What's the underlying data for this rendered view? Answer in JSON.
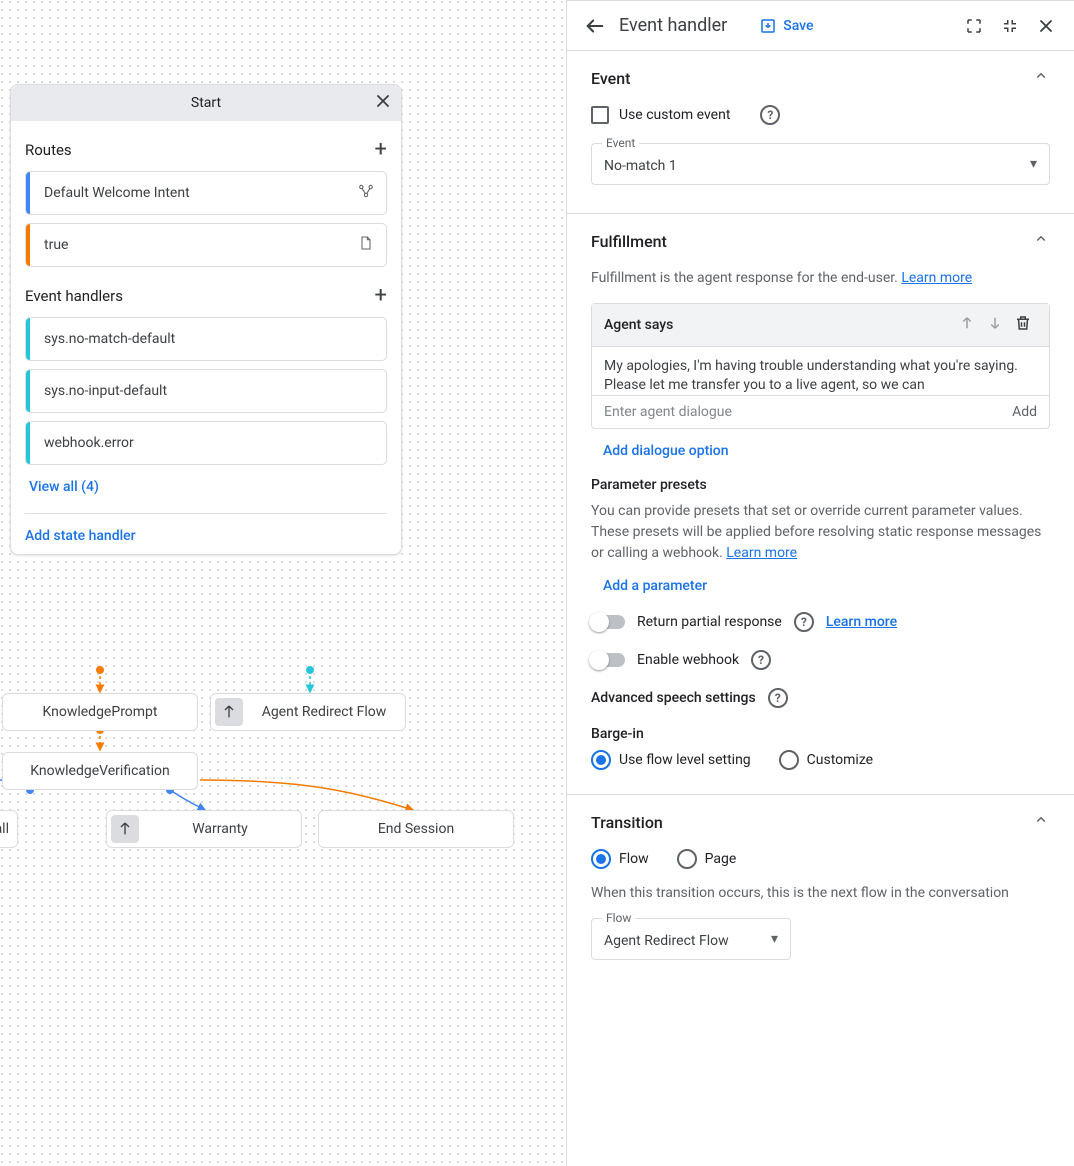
{
  "canvas": {
    "start_title": "Start",
    "routes_label": "Routes",
    "routes": [
      {
        "label": "Default Welcome Intent",
        "bar": "bar-blue",
        "icon": "branch"
      },
      {
        "label": "true",
        "bar": "bar-orange",
        "icon": "doc"
      }
    ],
    "handlers_label": "Event handlers",
    "handlers": [
      {
        "label": "sys.no-match-default",
        "bar": "bar-teal"
      },
      {
        "label": "sys.no-input-default",
        "bar": "bar-teal"
      },
      {
        "label": "webhook.error",
        "bar": "bar-teal"
      }
    ],
    "view_all": "View all (4)",
    "add_state": "Add state handler",
    "nodes": {
      "knowledge_prompt": "KnowledgePrompt",
      "agent_redirect": "Agent Redirect Flow",
      "knowledge_verif": "KnowledgeVerification",
      "partial": "all",
      "warranty": "Warranty",
      "end_session": "End Session"
    }
  },
  "panel": {
    "title": "Event handler",
    "save": "Save",
    "event_section": "Event",
    "use_custom": "Use custom event",
    "event_field_label": "Event",
    "event_value": "No-match 1",
    "fulfillment_section": "Fulfillment",
    "fulfillment_desc": "Fulfillment is the agent response for the end-user. ",
    "learn_more": "Learn more",
    "agent_says": "Agent says",
    "agent_text": "My apologies, I'm having trouble understanding what you're saying. Please let me transfer you to a live agent, so we can",
    "enter_placeholder": "Enter agent dialogue",
    "add_text": "Add",
    "add_dialogue": "Add dialogue option",
    "param_presets": "Parameter presets",
    "param_desc": "You can provide presets that set or override current parameter values. These presets will be applied before resolving static response messages or calling a webhook. ",
    "add_param": "Add a parameter",
    "return_partial": "Return partial response",
    "enable_webhook": "Enable webhook",
    "adv_speech": "Advanced speech settings",
    "barge_in": "Barge-in",
    "use_flow_level": "Use flow level setting",
    "customize": "Customize",
    "transition_section": "Transition",
    "flow_opt": "Flow",
    "page_opt": "Page",
    "transition_desc": "When this transition occurs, this is the next flow in the conversation",
    "flow_field_label": "Flow",
    "flow_value": "Agent Redirect Flow"
  }
}
